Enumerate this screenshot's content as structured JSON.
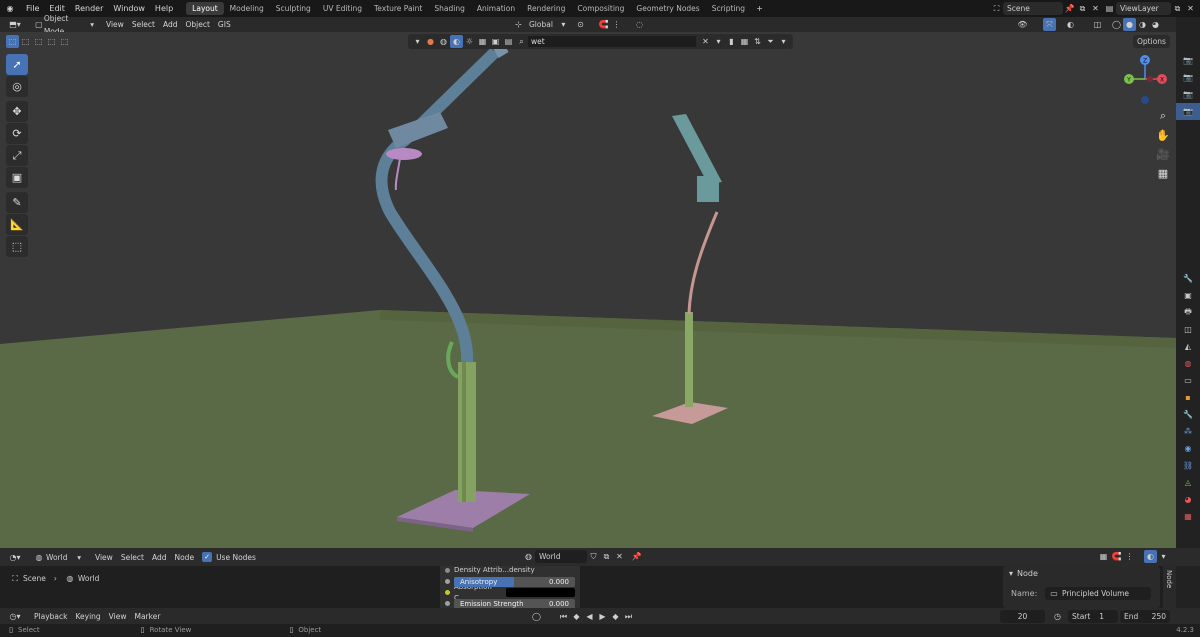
{
  "topbar": {
    "menus": [
      "File",
      "Edit",
      "Render",
      "Window",
      "Help"
    ],
    "workspaces": [
      {
        "label": "Layout",
        "active": true
      },
      {
        "label": "Modeling",
        "active": false
      },
      {
        "label": "Sculpting",
        "active": false
      },
      {
        "label": "UV Editing",
        "active": false
      },
      {
        "label": "Texture Paint",
        "active": false
      },
      {
        "label": "Shading",
        "active": false
      },
      {
        "label": "Animation",
        "active": false
      },
      {
        "label": "Rendering",
        "active": false
      },
      {
        "label": "Compositing",
        "active": false
      },
      {
        "label": "Geometry Nodes",
        "active": false
      },
      {
        "label": "Scripting",
        "active": false
      }
    ],
    "add_tab": "+",
    "scene": "Scene",
    "view_layer": "ViewLayer"
  },
  "viewport_header": {
    "mode": "Object Mode",
    "menus": [
      "View",
      "Select",
      "Add",
      "Object",
      "GIS"
    ],
    "orientation": "Global",
    "search_value": "wet",
    "options_label": "Options"
  },
  "toolbar": {
    "tools": [
      {
        "name": "select-box-tool",
        "glyph": "➚",
        "active": true
      },
      {
        "name": "cursor-tool",
        "glyph": "◎",
        "active": false
      },
      {
        "name": "move-tool",
        "glyph": "✥",
        "active": false
      },
      {
        "name": "rotate-tool",
        "glyph": "⟳",
        "active": false
      },
      {
        "name": "scale-tool",
        "glyph": "⤢",
        "active": false
      },
      {
        "name": "transform-tool",
        "glyph": "▣",
        "active": false
      },
      {
        "name": "annotate-tool",
        "glyph": "✎",
        "active": false
      },
      {
        "name": "measure-tool",
        "glyph": "📐",
        "active": false
      },
      {
        "name": "add-cube-tool",
        "glyph": "⬚",
        "active": false
      }
    ]
  },
  "gizmo": {
    "x": "X",
    "y": "Y",
    "z": "Z"
  },
  "node_editor": {
    "header": {
      "type": "World",
      "menus": [
        "View",
        "Select",
        "Add",
        "Node"
      ],
      "use_nodes_label": "Use Nodes",
      "use_nodes": true,
      "world_name": "World"
    },
    "breadcrumb": [
      "Scene",
      "World"
    ],
    "node_fields": [
      {
        "label": "Density Attrib...",
        "value": "density",
        "kind": "text",
        "socket": "#8c8c8c"
      },
      {
        "label": "Anisotropy",
        "value": "0.000",
        "kind": "slider",
        "fill": 0.5,
        "socket": "#a1a1a1"
      },
      {
        "label": "Absorption C...",
        "value": "",
        "kind": "color",
        "swatch": "#000000",
        "socket": "#c7c729"
      },
      {
        "label": "Emission Strength",
        "value": "0.000",
        "kind": "slider",
        "fill": 0.0,
        "socket": "#a1a1a1"
      }
    ],
    "side_panel": {
      "section": "Node",
      "name_label": "Name:",
      "name_value": "Principled Volume",
      "tab": "Node"
    }
  },
  "timeline": {
    "menus": [
      "Playback",
      "Keying",
      "View",
      "Marker"
    ],
    "current_frame": "20",
    "start_label": "Start",
    "start_value": "1",
    "end_label": "End",
    "end_value": "250"
  },
  "statusbar": {
    "items": [
      "Select",
      "Rotate View",
      "Object"
    ],
    "version": "4.2.3"
  },
  "colors": {
    "accent": "#4772b3",
    "viewport_bg": "#383838",
    "ground": "#5b6a46"
  }
}
